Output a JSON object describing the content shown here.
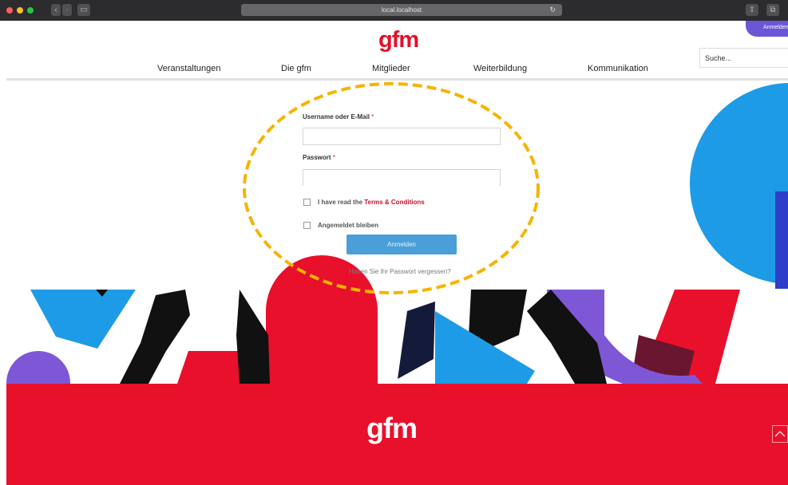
{
  "browser": {
    "url": "local.localhost",
    "login_label": "Anmelden"
  },
  "header": {
    "logo": "gfm",
    "nav": [
      {
        "label": "Veranstaltungen"
      },
      {
        "label": "Die gfm"
      },
      {
        "label": "Mitglieder"
      },
      {
        "label": "Weiterbildung"
      },
      {
        "label": "Kommunikation"
      }
    ],
    "search_placeholder": "Suche..."
  },
  "login_form": {
    "username_label": "Username oder E-Mail",
    "password_label": "Passwort",
    "required_mark": "*",
    "terms_prefix": "I have read the",
    "terms_link": "Terms & Conditions",
    "remember_label": "Angemeldet bleiben",
    "submit_label": "Anmelden",
    "forgot_link": "Haben Sie Ihr Passwort vergessen?"
  },
  "footer": {
    "logo": "gfm"
  },
  "colors": {
    "brand_red": "#e3102a",
    "button_blue": "#4a9fd8",
    "purple": "#7e57d6",
    "highlight_yellow": "#f5b400"
  }
}
